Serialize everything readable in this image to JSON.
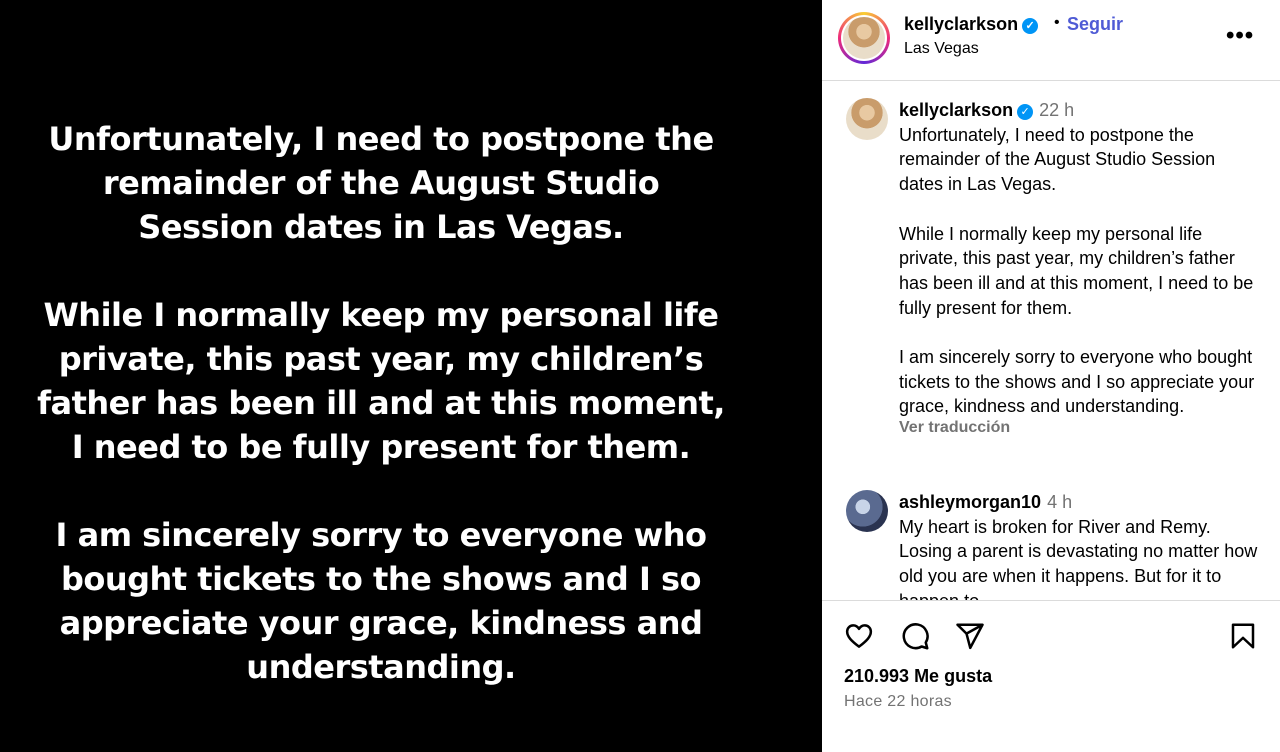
{
  "media": {
    "paragraphs": [
      "Unfortunately, I need to postpone the remainder of the August Studio Session dates in Las Vegas.",
      "While I normally keep my personal life private, this past year, my children’s father has been ill and at this moment, I need to be fully present for them.",
      "I am sincerely sorry to everyone who bought tickets to the shows and I so appreciate your grace, kindness and understanding."
    ]
  },
  "header": {
    "username": "kellyclarkson",
    "verified_icon": "verified-badge-icon",
    "separator": "•",
    "follow_label": "Seguir",
    "location": "Las Vegas",
    "more_icon": "more-options-icon",
    "more_glyph": "•••"
  },
  "caption": {
    "username": "kellyclarkson",
    "time": "22 h",
    "paragraphs": [
      "Unfortunately, I need to postpone the remainder of the August Studio Session dates in Las Vegas.",
      "While I normally keep my personal life private, this past year, my children’s father has been ill and at this moment, I need to be fully present for them.",
      "I am sincerely sorry to everyone who bought tickets to the shows and I so appreciate your grace, kindness and understanding."
    ],
    "translate_label": "Ver traducción"
  },
  "comment": {
    "username": "ashleymorgan10",
    "time": "4 h",
    "text": "My heart is broken for River and Remy. Losing a parent is devastating no matter how old you are when it happens. But for it to happen to"
  },
  "actions": {
    "icons": [
      "heart-icon",
      "comment-icon",
      "share-icon",
      "bookmark-icon"
    ],
    "likes": "210.993 Me gusta",
    "posted_ago": "Hace 22 horas"
  },
  "colors": {
    "accent": "#4f5bd5",
    "verified": "#0095f6",
    "muted": "#737373",
    "media_bg": "#000000"
  }
}
